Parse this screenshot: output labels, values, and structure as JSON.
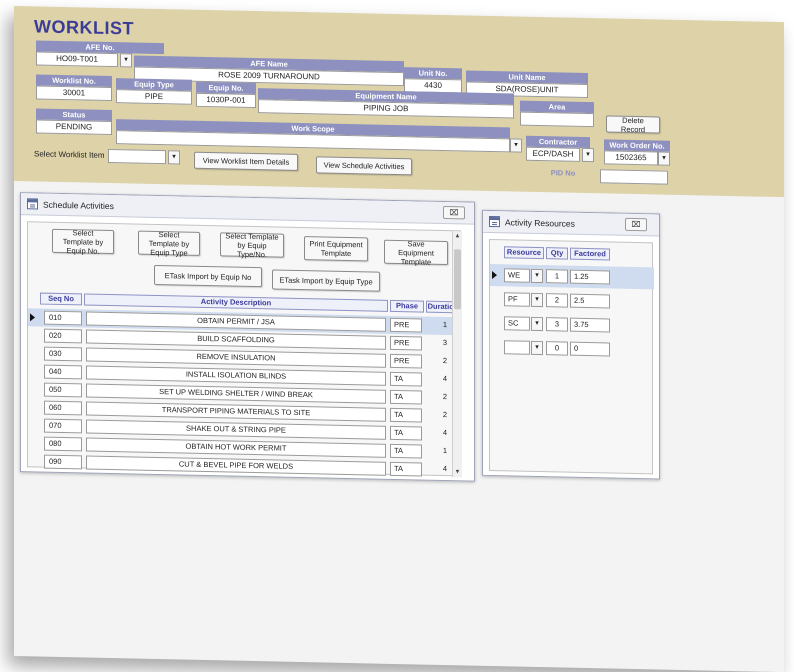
{
  "title": "WORKLIST",
  "afe_no": {
    "label": "AFE No.",
    "value": "HO09-T001"
  },
  "afe_name": {
    "label": "AFE Name",
    "value": "ROSE 2009 TURNAROUND"
  },
  "unit_no": {
    "label": "Unit No.",
    "value": "4430"
  },
  "unit_name": {
    "label": "Unit Name",
    "value": "SDA(ROSE)UNIT"
  },
  "worklist_no": {
    "label": "Worklist No.",
    "value": "30001"
  },
  "equip_type": {
    "label": "Equip Type",
    "value": "PIPE"
  },
  "equip_no": {
    "label": "Equip No.",
    "value": "1030P-001"
  },
  "equipment_name": {
    "label": "Equipment Name",
    "value": "PIPING JOB"
  },
  "area": {
    "label": "Area",
    "value": ""
  },
  "status": {
    "label": "Status",
    "value": "PENDING"
  },
  "work_scope": {
    "label": "Work Scope",
    "value": ""
  },
  "contractor": {
    "label": "Contractor",
    "value": "ECP/DASH"
  },
  "work_order_no": {
    "label": "Work Order No.",
    "value": "1502365"
  },
  "pid_no": {
    "label": "PID No",
    "value": ""
  },
  "delete_record": "Delete Record",
  "select_worklist_item": {
    "label": "Select Worklist Item",
    "value": ""
  },
  "view_item_details": "View Worklist Item Details",
  "view_schedule_activities": "View Schedule Activities",
  "schedule_panel": {
    "title": "Schedule Activities",
    "close": "⌧",
    "buttons": {
      "select_by_equip_no": "Select Template by Equip No.",
      "select_by_equip_type": "Select Template by Equip Type",
      "select_by_type_no": "Select Template by Equip Type/No.",
      "print_equipment_template": "Print Equipment Template",
      "save_equipment_template": "Save Equipment Template",
      "etask_by_equip_no": "ETask Import by Equip No",
      "etask_by_equip_type": "ETask Import by Equip Type"
    },
    "columns": {
      "seq": "Seq No",
      "desc": "Activity Description",
      "phase": "Phase",
      "duration": "Duration"
    },
    "rows": [
      {
        "seq": "010",
        "desc": "OBTAIN PERMIT / JSA",
        "phase": "PRE",
        "duration": "1"
      },
      {
        "seq": "020",
        "desc": "BUILD SCAFFOLDING",
        "phase": "PRE",
        "duration": "3"
      },
      {
        "seq": "030",
        "desc": "REMOVE INSULATION",
        "phase": "PRE",
        "duration": "2"
      },
      {
        "seq": "040",
        "desc": "INSTALL ISOLATION BLINDS",
        "phase": "TA",
        "duration": "4"
      },
      {
        "seq": "050",
        "desc": "SET UP WELDING SHELTER / WIND BREAK",
        "phase": "TA",
        "duration": "2"
      },
      {
        "seq": "060",
        "desc": "TRANSPORT PIPING MATERIALS TO SITE",
        "phase": "TA",
        "duration": "2"
      },
      {
        "seq": "070",
        "desc": "SHAKE OUT & STRING PIPE",
        "phase": "TA",
        "duration": "4"
      },
      {
        "seq": "080",
        "desc": "OBTAIN HOT WORK PERMIT",
        "phase": "TA",
        "duration": "1"
      },
      {
        "seq": "090",
        "desc": "CUT & BEVEL PIPE FOR WELDS",
        "phase": "TA",
        "duration": "4"
      }
    ]
  },
  "resources_panel": {
    "title": "Activity Resources",
    "close": "⌧",
    "columns": {
      "resource": "Resource",
      "qty": "Qty",
      "factored": "Factored"
    },
    "rows": [
      {
        "resource": "WE",
        "qty": "1",
        "factored": "1.25"
      },
      {
        "resource": "PF",
        "qty": "2",
        "factored": "2.5"
      },
      {
        "resource": "SC",
        "qty": "3",
        "factored": "3.75"
      },
      {
        "resource": "",
        "qty": "0",
        "factored": "0"
      }
    ]
  },
  "dropdown_glyph": "▾",
  "scroll_up": "▲",
  "scroll_down": "▼"
}
